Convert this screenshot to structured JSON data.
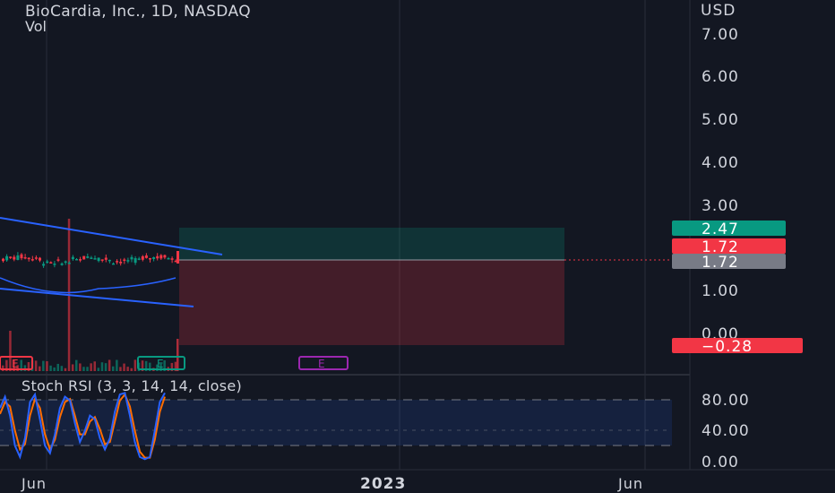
{
  "header": {
    "symbol_title": "BioCardia, Inc., 1D, NASDAQ",
    "volume_label": "Vol"
  },
  "price_axis": {
    "currency": "USD",
    "ticks": [
      "7.00",
      "6.00",
      "5.00",
      "4.00",
      "3.00",
      "1.00",
      "0.00"
    ]
  },
  "price_tags": [
    {
      "label": "2.47",
      "color": "#089981",
      "value": 2.47
    },
    {
      "label": "1.72",
      "color": "#f23645",
      "value": 1.72
    },
    {
      "label": "1.72",
      "color": "#787b86",
      "value": 1.72
    },
    {
      "label": "−0.28",
      "color": "#f23645",
      "value": -0.28
    }
  ],
  "earnings_markers": [
    {
      "label": "E",
      "color": "#f23645"
    },
    {
      "label": "E",
      "color": "#089981"
    },
    {
      "label": "E",
      "color": "#9c27b0"
    }
  ],
  "stoch": {
    "title": "Stoch RSI (3, 3, 14, 14, close)",
    "ticks": [
      "80.00",
      "40.00",
      "0.00"
    ],
    "upper_band": 80,
    "lower_band": 20
  },
  "time_axis": {
    "labels": [
      "Jun",
      "2023",
      "Jun"
    ]
  },
  "colors": {
    "background": "#131722",
    "trendline": "#2962ff",
    "k_line": "#2962ff",
    "d_line": "#ff6d00",
    "up_candle": "#089981",
    "down_candle": "#f23645"
  },
  "chart_data": {
    "type": "candlestick",
    "title": "BioCardia, Inc., 1D, NASDAQ",
    "ylim": [
      -0.6,
      7.4
    ],
    "current_price": 1.72,
    "position_tool": {
      "target": 2.47,
      "entry": 1.72,
      "stop": -0.28
    },
    "series": [
      {
        "name": "Stoch RSI K",
        "values": [
          70,
          85,
          60,
          20,
          5,
          30,
          78,
          88,
          55,
          20,
          10,
          35,
          70,
          85,
          80,
          50,
          25,
          40,
          60,
          55,
          30,
          15,
          30,
          65,
          88,
          90,
          60,
          25,
          5,
          2,
          5,
          40,
          78,
          90
        ]
      },
      {
        "name": "Stoch RSI D",
        "values": [
          62,
          78,
          72,
          40,
          15,
          22,
          60,
          82,
          70,
          35,
          15,
          28,
          58,
          78,
          82,
          60,
          35,
          35,
          52,
          58,
          42,
          22,
          25,
          52,
          80,
          88,
          72,
          40,
          12,
          4,
          4,
          28,
          65,
          85
        ]
      }
    ]
  }
}
